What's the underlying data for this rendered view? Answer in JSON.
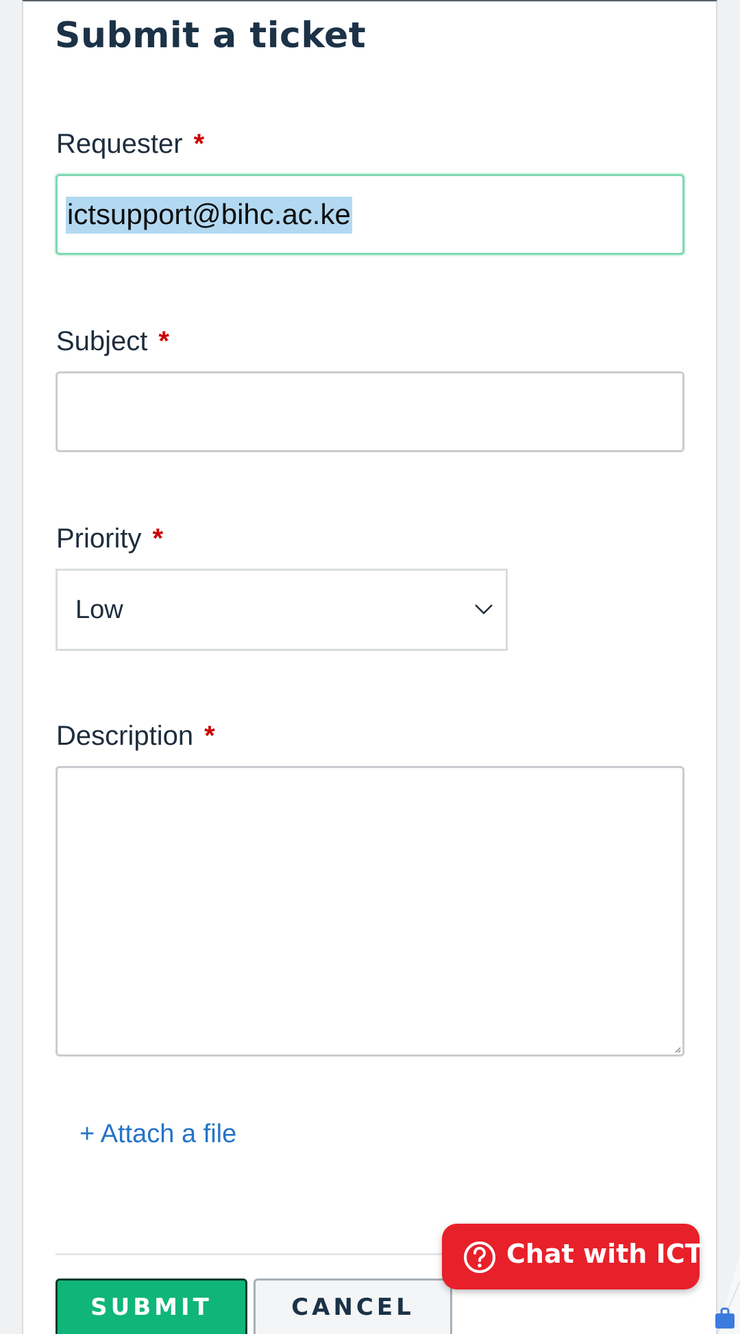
{
  "form": {
    "title": "Submit a ticket",
    "required_marker": "*",
    "requester": {
      "label": "Requester",
      "value": "ictsupport@bihc.ac.ke"
    },
    "subject": {
      "label": "Subject",
      "value": ""
    },
    "priority": {
      "label": "Priority",
      "selected": "Low"
    },
    "description": {
      "label": "Description",
      "value": ""
    },
    "attach_label": "+ Attach a file",
    "submit_label": "SUBMIT",
    "cancel_label": "CANCEL"
  },
  "chat_widget": {
    "label": "Chat with ICT",
    "icon": "question-circle-icon"
  },
  "icons": {
    "priority_dropdown": "chevron-down-icon",
    "resize": "resize-handle-icon",
    "corner": "briefcase-icon"
  },
  "colors": {
    "title": "#1b3247",
    "required": "#cc0000",
    "focus_border": "#7fd9b3",
    "selection_highlight": "#b3d9f2",
    "link": "#2474c6",
    "submit": "#10b57a",
    "chat": "#e8202a",
    "background": "#eff1f3"
  }
}
